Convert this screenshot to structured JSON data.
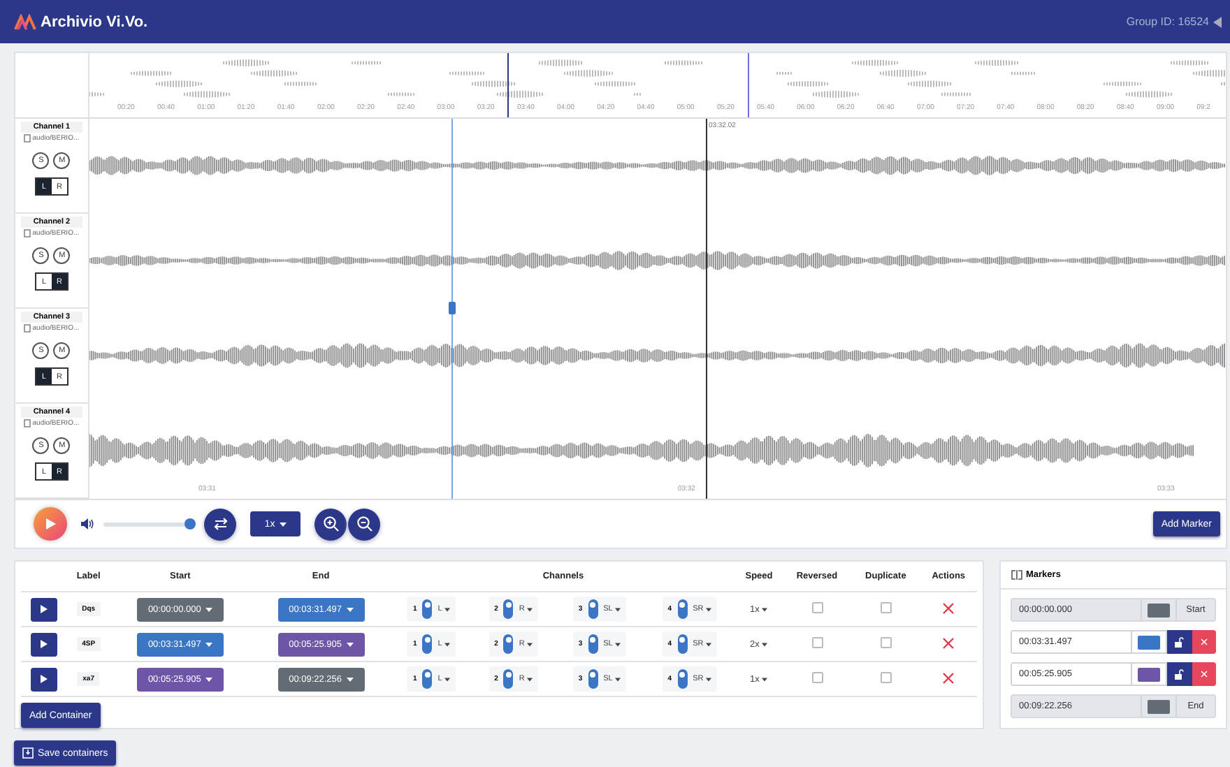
{
  "header": {
    "title": "Archivio Vi.Vo.",
    "group_id": "Group ID: 16524"
  },
  "overview": {
    "ticks": [
      "00:20",
      "00:40",
      "01:00",
      "01:20",
      "01:40",
      "02:00",
      "02:20",
      "02:40",
      "03:00",
      "03:20",
      "03:40",
      "04:00",
      "04:20",
      "04:40",
      "05:00",
      "05:20",
      "05:40",
      "06:00",
      "06:20",
      "06:40",
      "07:00",
      "07:20",
      "07:40",
      "08:00",
      "08:20",
      "08:40",
      "09:00",
      "09:2"
    ],
    "cursor_time": "03:32.02"
  },
  "channels": [
    {
      "name": "Channel 1",
      "file": "audio/BERIO...",
      "solo": "S",
      "mute": "M",
      "pan": [
        {
          "label": "L",
          "selected": true
        },
        {
          "label": "R",
          "selected": false
        }
      ]
    },
    {
      "name": "Channel 2",
      "file": "audio/BERIO...",
      "solo": "S",
      "mute": "M",
      "pan": [
        {
          "label": "L",
          "selected": false
        },
        {
          "label": "R",
          "selected": true
        }
      ]
    },
    {
      "name": "Channel 3",
      "file": "audio/BERIO...",
      "solo": "S",
      "mute": "M",
      "pan": [
        {
          "label": "L",
          "selected": true
        },
        {
          "label": "R",
          "selected": false
        }
      ]
    },
    {
      "name": "Channel 4",
      "file": "audio/BERIO...",
      "solo": "S",
      "mute": "M",
      "pan": [
        {
          "label": "L",
          "selected": false
        },
        {
          "label": "R",
          "selected": true
        }
      ]
    }
  ],
  "detail_ticks": [
    "03:31",
    "03:32",
    "03:33"
  ],
  "transport": {
    "volume": {
      "level": 1
    },
    "speed": "1x",
    "add_marker": "Add Marker"
  },
  "containers": {
    "columns": [
      "Label",
      "Start",
      "End",
      "Channels",
      "Speed",
      "Reversed",
      "Duplicate",
      "Actions"
    ],
    "rows": [
      {
        "label": "Dqs",
        "start": {
          "value": "00:00:00.000",
          "color": "#636c74"
        },
        "end": {
          "value": "00:03:31.497",
          "color": "#3a76c4"
        },
        "channels": [
          {
            "number": "1",
            "on": true,
            "pan": "L"
          },
          {
            "number": "2",
            "on": true,
            "pan": "R"
          },
          {
            "number": "3",
            "on": true,
            "pan": "SL"
          },
          {
            "number": "4",
            "on": true,
            "pan": "SR"
          }
        ],
        "speed": "1x",
        "reversed": false,
        "duplicate": false
      },
      {
        "label": "4SP",
        "start": {
          "value": "00:03:31.497",
          "color": "#3a76c4"
        },
        "end": {
          "value": "00:05:25.905",
          "color": "#6d55a8"
        },
        "channels": [
          {
            "number": "1",
            "on": true,
            "pan": "L"
          },
          {
            "number": "2",
            "on": true,
            "pan": "R"
          },
          {
            "number": "3",
            "on": true,
            "pan": "SL"
          },
          {
            "number": "4",
            "on": true,
            "pan": "SR"
          }
        ],
        "speed": "2x",
        "reversed": false,
        "duplicate": false
      },
      {
        "label": "xa7",
        "start": {
          "value": "00:05:25.905",
          "color": "#6d55a8"
        },
        "end": {
          "value": "00:09:22.256",
          "color": "#636c74"
        },
        "channels": [
          {
            "number": "1",
            "on": true,
            "pan": "L"
          },
          {
            "number": "2",
            "on": true,
            "pan": "R"
          },
          {
            "number": "3",
            "on": true,
            "pan": "SL"
          },
          {
            "number": "4",
            "on": true,
            "pan": "SR"
          }
        ],
        "speed": "1x",
        "reversed": false,
        "duplicate": false
      }
    ],
    "add_button": "Add Container"
  },
  "markers": {
    "title": "Markers",
    "items": [
      {
        "kind": "fixed",
        "time": "00:00:00.000",
        "color": "#636c74",
        "label": "Start"
      },
      {
        "kind": "movable",
        "time": "00:03:31.497",
        "color": "#3a76c4"
      },
      {
        "kind": "movable",
        "time": "00:05:25.905",
        "color": "#6d55a8"
      },
      {
        "kind": "fixed",
        "time": "00:09:22.256",
        "color": "#636c74",
        "label": "End"
      }
    ]
  },
  "save_button": "Save containers"
}
